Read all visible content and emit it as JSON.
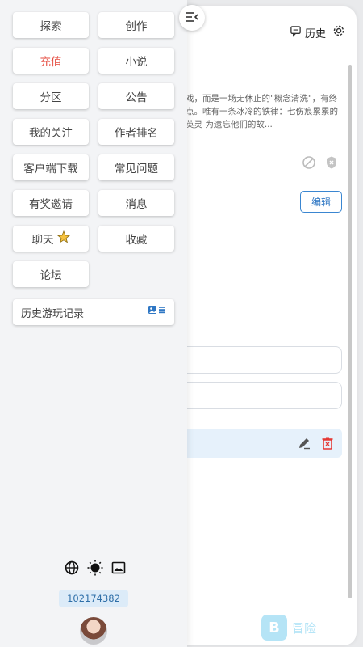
{
  "main": {
    "history_label": "历史",
    "description": "戏，而是一场无休止的\"概念清洗\"，有终点。唯有一条冰冷的铁律：七伤痕累累的英灵 为遗忘他们的故...",
    "edit_label": "编辑"
  },
  "menu": {
    "items": [
      {
        "label": "探索"
      },
      {
        "label": "创作"
      },
      {
        "label": "充值",
        "color": "#e5483c"
      },
      {
        "label": "小说"
      },
      {
        "label": "分区"
      },
      {
        "label": "公告"
      },
      {
        "label": "我的关注"
      },
      {
        "label": "作者排名"
      },
      {
        "label": "客户端下载"
      },
      {
        "label": "常见问题"
      },
      {
        "label": "有奖邀请"
      },
      {
        "label": "消息"
      },
      {
        "label": "聊天",
        "badge_icon": "star-icon"
      },
      {
        "label": "收藏"
      },
      {
        "label": "论坛"
      }
    ]
  },
  "history_bar": {
    "label": "历史游玩记录",
    "icon": "list-view-icon"
  },
  "bottom": {
    "icons": [
      "globe-icon",
      "theme-toggle-icon",
      "image-icon"
    ],
    "user_id": "102174382"
  },
  "brand": {
    "text": "冒险"
  }
}
